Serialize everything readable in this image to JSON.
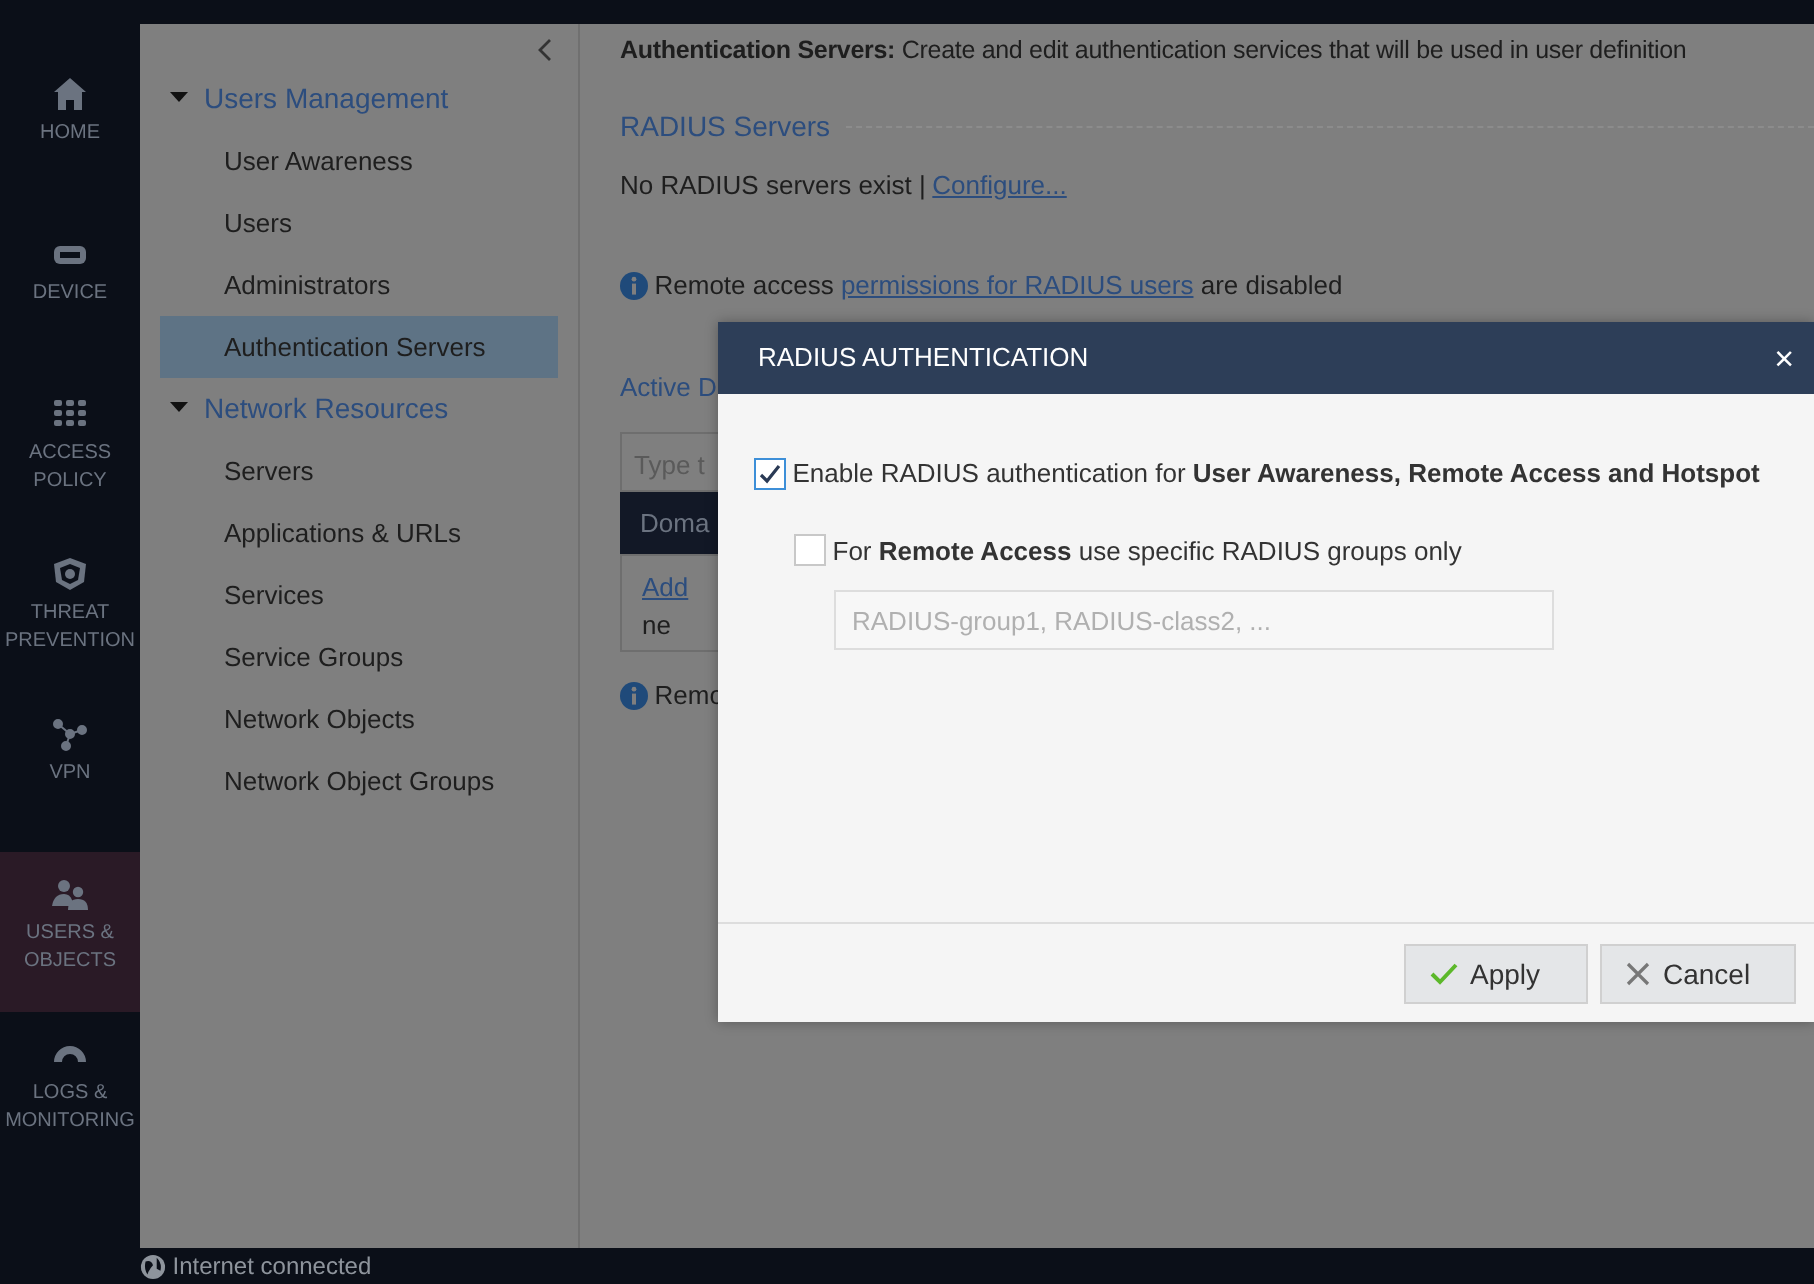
{
  "nav_rail": [
    {
      "label": "HOME",
      "selected": false
    },
    {
      "label": "DEVICE",
      "selected": false
    },
    {
      "label": "ACCESS POLICY",
      "selected": false
    },
    {
      "label": "THREAT PREVENTION",
      "selected": false
    },
    {
      "label": "VPN",
      "selected": false
    },
    {
      "label": "USERS & OBJECTS",
      "selected": true
    },
    {
      "label": "LOGS & MONITORING",
      "selected": false
    }
  ],
  "sidebar": {
    "groups": [
      {
        "label": "Users Management",
        "expanded": true,
        "children": [
          {
            "label": "User Awareness",
            "selected": false
          },
          {
            "label": "Users",
            "selected": false
          },
          {
            "label": "Administrators",
            "selected": false
          },
          {
            "label": "Authentication Servers",
            "selected": true
          }
        ]
      },
      {
        "label": "Network Resources",
        "expanded": true,
        "children": [
          {
            "label": "Servers",
            "selected": false
          },
          {
            "label": "Applications & URLs",
            "selected": false
          },
          {
            "label": "Services",
            "selected": false
          },
          {
            "label": "Service Groups",
            "selected": false
          },
          {
            "label": "Network Objects",
            "selected": false
          },
          {
            "label": "Network Object Groups",
            "selected": false
          }
        ]
      }
    ]
  },
  "content": {
    "description": "**Authentication Servers:** Create and edit authentication services that will be used in user definition",
    "radius_section": {
      "heading": "RADIUS Servers",
      "status_text": "No RADIUS servers exist |",
      "link": "Configure..."
    },
    "notice": {
      "text_before": "Remote access",
      "link": "permissions for RADIUS users",
      "text_after": "are disabled"
    },
    "active_directory": {
      "heading": "Active D",
      "search_placeholder": "Type t",
      "column_1": "Doma",
      "add_link": "Add",
      "add_text": "ne",
      "notice": "Remo"
    }
  },
  "dialog": {
    "title": "RADIUS AUTHENTICATION",
    "close": "×",
    "options": [
      {
        "label": "Enable RADIUS authentication for **User Awareness, Remote Access and Hotspot**",
        "checked": true,
        "children": [
          {
            "label": "For **Remote Access** use specific RADIUS groups only",
            "checked": false,
            "field_placeholder": "RADIUS-group1, RADIUS-class2, ..."
          }
        ]
      }
    ],
    "buttons": [
      {
        "label": "Apply",
        "kind": "apply"
      },
      {
        "label": "Cancel",
        "kind": "cancel"
      }
    ]
  },
  "status_bar": {
    "text": "Internet connected"
  }
}
